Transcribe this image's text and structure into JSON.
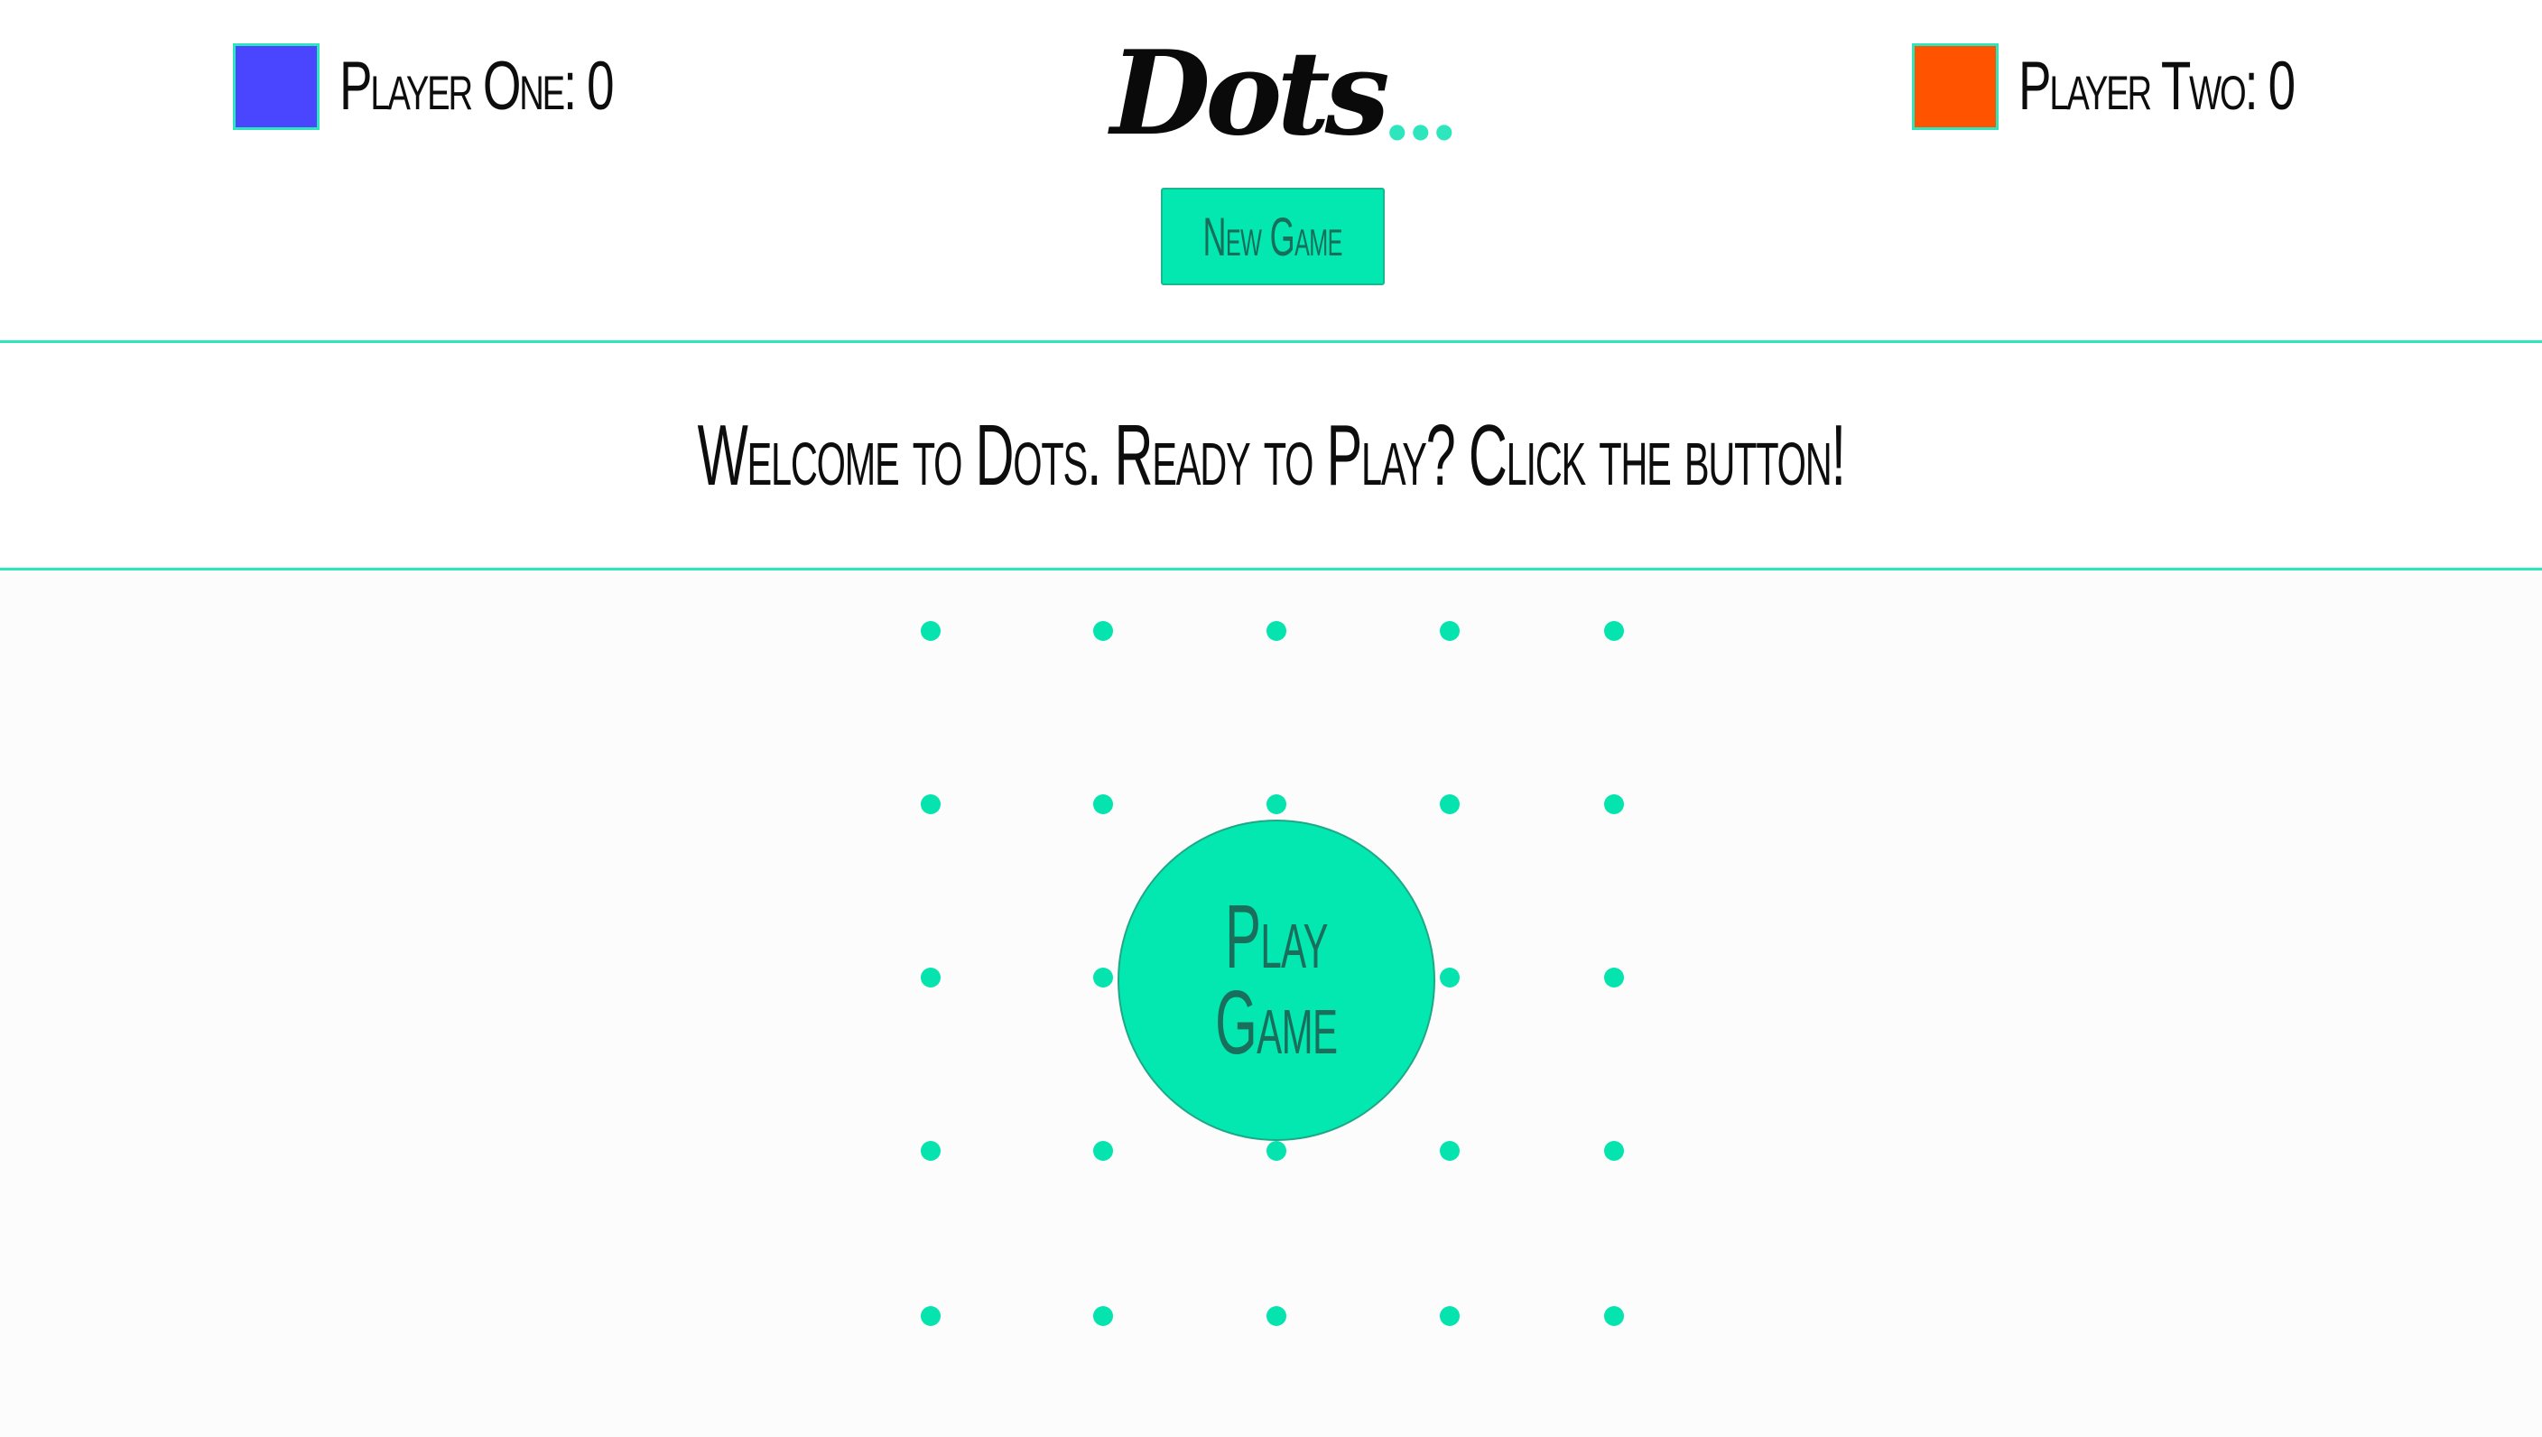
{
  "header": {
    "player_one": {
      "label": "Player One: 0",
      "color": "#4a45ff"
    },
    "player_two": {
      "label": "Player Two: 0",
      "color": "#ff5300"
    },
    "logo": {
      "word": "Dots",
      "dots": "..."
    },
    "new_game_label": "New Game"
  },
  "banner": {
    "message": "Welcome to Dots. Ready to Play? Click the button!"
  },
  "board": {
    "rows": 5,
    "cols": 5,
    "dot_color": "#05e3ae",
    "play_button": {
      "line1": "Play",
      "line2": "Game"
    }
  },
  "colors": {
    "accent": "#2ee6bd",
    "button": "#03e8b0"
  }
}
